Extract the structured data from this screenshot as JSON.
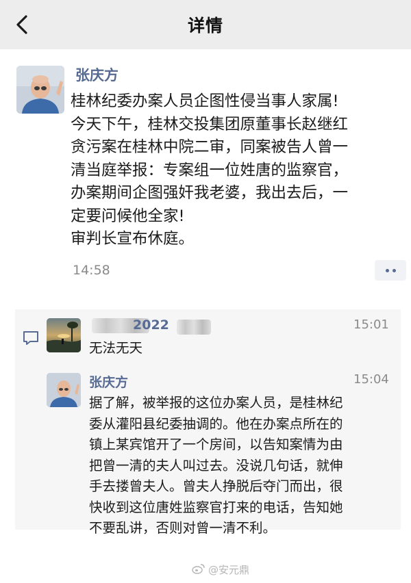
{
  "header": {
    "title": "详情"
  },
  "post": {
    "author": "张庆方",
    "body": "桂林纪委办案人员企图性侵当事人家属!\n今天下午，桂林交投集团原董事长赵继红\n贪污案在桂林中院二审，同案被告人曾一\n清当庭举报：专案组一位姓唐的监察官，\n办案期间企图强奸我老婆，我出去后，一\n定要问候他全家!\n审判长宣布休庭。",
    "time": "14:58"
  },
  "comments": [
    {
      "name": "2022",
      "time": "15:01",
      "text": "无法无天"
    },
    {
      "name": "张庆方",
      "time": "15:04",
      "text": "据了解，被举报的这位办案人员，是桂林纪\n委从灌阳县纪委抽调的。他在办案点所在的\n镇上某宾馆开了一个房间，以告知案情为由\n把曾一清的夫人叫过去。没说几句话，就伸\n手去搂曾夫人。曾夫人挣脱后夺门而出，很\n快收到这位唐姓监察官打来的电话，告知她\n不要乱讲，否则对曾一清不利。"
    }
  ],
  "watermark": {
    "text": "@安元鼎"
  },
  "colors": {
    "name_blue": "#576b95",
    "bg_gray": "#ededed",
    "comment_bg": "#f6f6f6"
  },
  "icons": [
    "back-chevron-icon",
    "more-dots-icon",
    "comment-bubble-icon",
    "weibo-icon"
  ]
}
